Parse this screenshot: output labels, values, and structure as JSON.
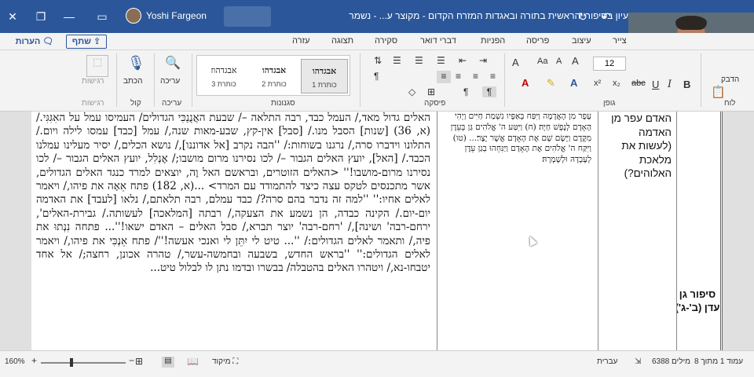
{
  "titlebar": {
    "title": "עיון בסיפורי הראשית בתורה ובאגדות המזרח הקדום - מקוצר ע... - נשמר",
    "user_name": "Yoshi Fargeon",
    "bg_color": "#2b579a"
  },
  "ribbon_tabs": {
    "notes": "הערות",
    "share": "שתף",
    "tabs": [
      "צייר",
      "עיצוב",
      "פריסה",
      "הפניות",
      "דברי דואר",
      "סקירה",
      "תצוגה",
      "עזרה"
    ]
  },
  "ribbon": {
    "clipboard": {
      "label": "לוח",
      "paste": "הדבק"
    },
    "font": {
      "label": "גופן",
      "size": "12",
      "bold": "B",
      "italic": "I",
      "underline": "U",
      "strike": "abc"
    },
    "paragraph": {
      "label": "פיסקה"
    },
    "styles": {
      "label": "סגנונות",
      "items": [
        {
          "sample": "אבגדהו",
          "name": "כותרת 1"
        },
        {
          "sample": "אבגדהו",
          "name": "כותרת 2"
        },
        {
          "sample": "אבגדהוז",
          "name": "כותרת 3"
        }
      ]
    },
    "editing": {
      "label": "עריכה",
      "button": "עריכה"
    },
    "voice": {
      "label": "קול",
      "button": "הכתב"
    },
    "sensitivity": {
      "label": "רגישות",
      "button": "רגישות"
    }
  },
  "document": {
    "side_title": "סיפור גן עדן (ב'-ג')",
    "question": "האדם עפר מן האדמה (לעשות את מלאכת האלוהים?)",
    "verse": "עָפָר מִן הָאֲדָמָה וַיִּפַּח בְּאַפָּיו נִשְׁמַת חַיִּים וַיְהִי הָאָדָם לְנֶפֶשׁ חַיָּה׃ (ח) וַיִּטַּע ה' אֱלֹהִים גַּן בְּעֵדֶן מִקֶּדֶם וַיָּשֶׂם שָׁם אֶת הָאָדָם אֲשֶׁר יָצָר׃... (טו) וַיִּקַּח ה' אֱלֹהִים אֶת הָאָדָם וַיַּנִּחֵהוּ בְגַן עֵדֶן לְעָבְדָהּ וּלְשָׁמְרָהּ׃",
    "main_text": "האלים גדול מאד,/ העמל כבד, רבה התלאה –/ שבעת האֲנֻנַכִּי הגדולים/ העמיסו עמל על האִגִּגִּי./ (א, 36) [שנות] הסבל מנו./ [סבל] אין-קץ, שבע-מאות שנה,/ עמל [כבד] עמסו לילה ויום./ התלונו וידברו סרה,/ נרגנו בשוחות:/ ''הבה נקרב [אל אדוננו],/ נושא הכלים,/ יסיר מעלינו עמלנו הכבד./ [האל], יועץ האלים הגבור –/ לכו נסירנו מרום מושבו;/ אֶנְלִל, יועץ האלים הגבור –/ לכו נסירנו מרום-מושבו!'' <האלים הזוטרים, ובראשם האל וֶה, יוצאים למרד כנגד האלים הגדולים, אשר מתכנסים לטקס עצה כיצד להתמודד עם המרד> ...(א, 182) פתח אֵאָה את פיהו,/ ויאמר לאלים אחיו:'' ''למה זה נדבר בהם סרה?/ כבד עמלם, רבה תלאתם,/ נלאו [לעבד] את האדמה יום-יום./ הקינה כבדה, הן נשמע את הצעקה,/ רבתה [המלאכה] לעשותה./ גבירת-האלים', ירחם-רבה' ושינה],/ 'רחם-רבה' יוצר תברא,/ סבל האלים – האדם ישאו!''... פתחה נִנְתוּ את פיה,/ ותאמר לאלים הגדולים:/ ''... טיט לי יִתֵּן לי ואנכי אעשה!''/ פתח אֵנְכִּי את פיהו,/ ויאמר לאלים הגדולים:'' ''בראש החדש, בשבעה ובחמשה-עשר,/ טהרה אכונן, רחצה;/ אל אחד יטבחו-נא,/ ויטהרו האלים בהטבלה/ בבשרו ובדמו נתן לו לבלול טיט..."
  },
  "statusbar": {
    "page": "עמוד 1 מתוך 8",
    "words": "6388 מילים",
    "language": "עברית",
    "focus": "מיקוד",
    "zoom": "160%",
    "zoom_fraction": 0.34
  }
}
